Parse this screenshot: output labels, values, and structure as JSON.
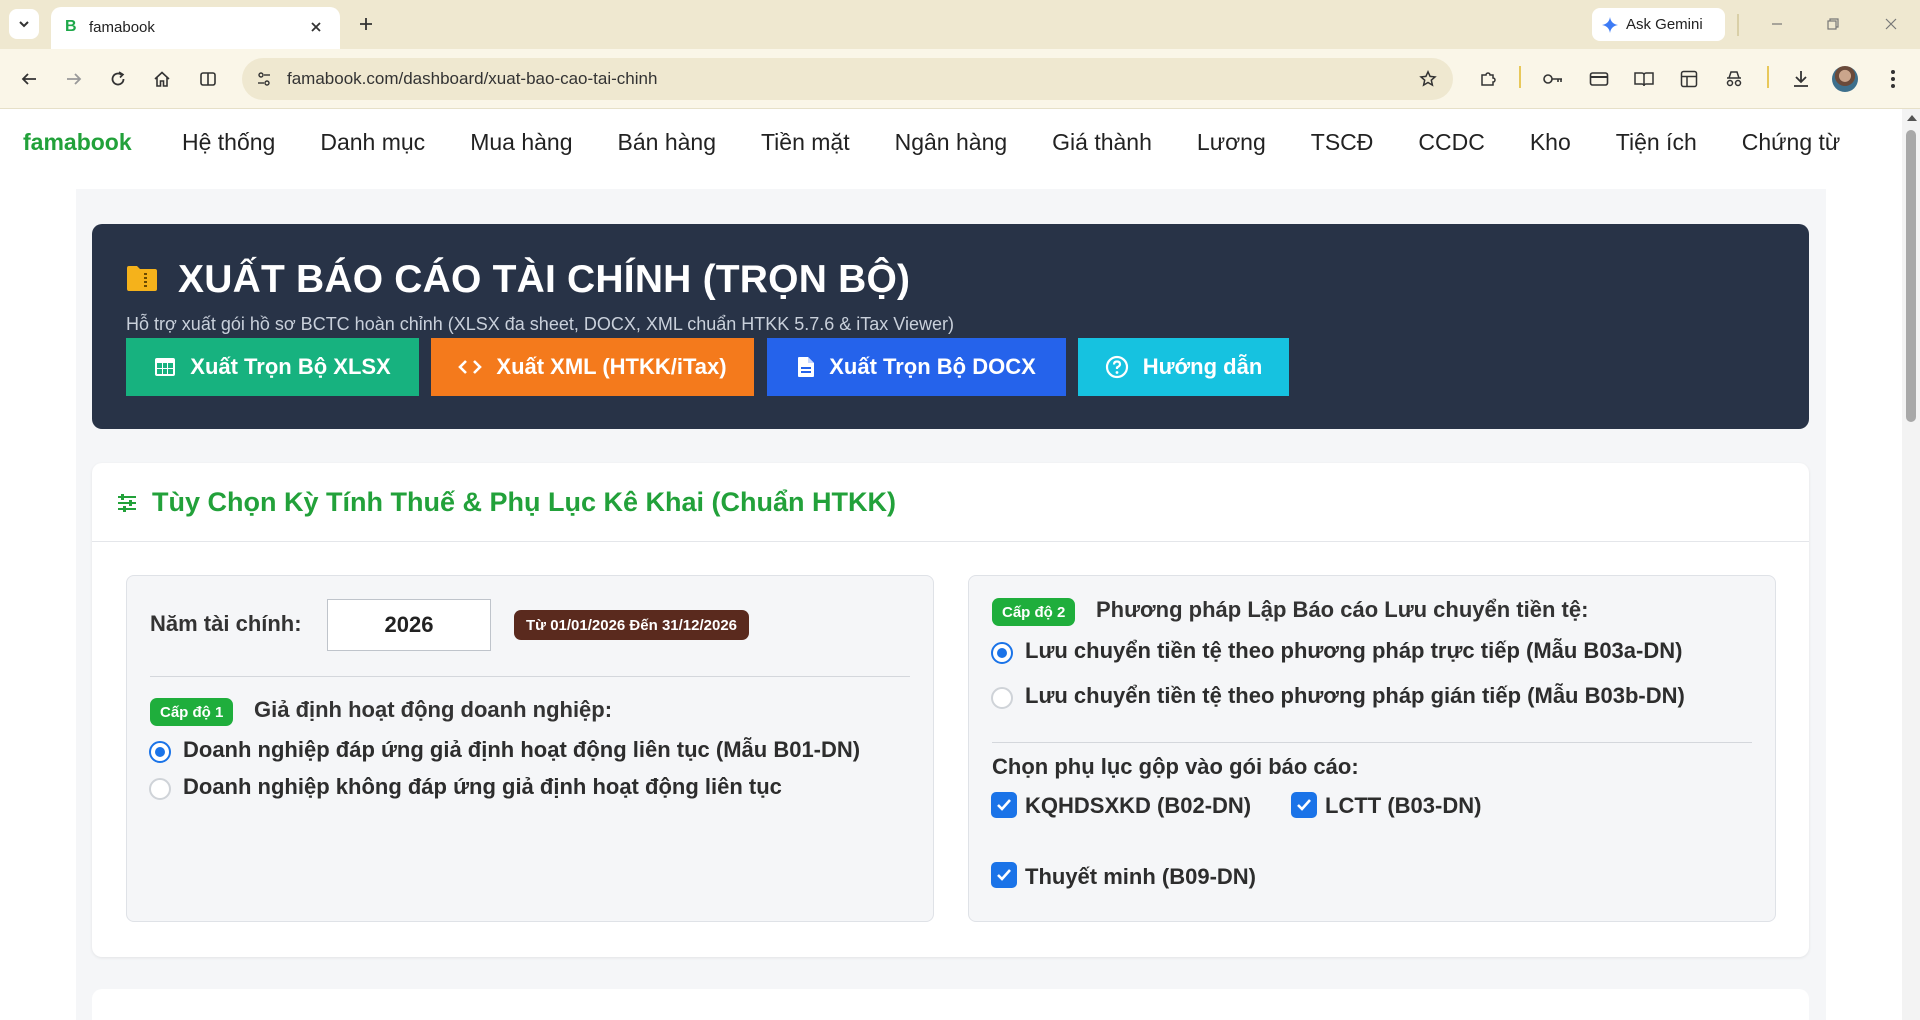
{
  "browser": {
    "tab_title": "famabook",
    "tab_favicon": "B",
    "url": "famabook.com/dashboard/xuat-bao-cao-tai-chinh",
    "gemini_label": "Ask Gemini"
  },
  "topnav": {
    "brand": "famabook",
    "items": [
      "Hệ thống",
      "Danh mục",
      "Mua hàng",
      "Bán hàng",
      "Tiền mặt",
      "Ngân hàng",
      "Giá thành",
      "Lương",
      "TSCĐ",
      "CCDC",
      "Kho",
      "Tiện ích",
      "Chứng từ"
    ]
  },
  "hero": {
    "icon": "folder-icon",
    "title": "XUẤT BÁO CÁO TÀI CHÍNH (TRỌN BỘ)",
    "subtitle": "Hỗ trợ xuất gói hồ sơ BCTC hoàn chỉnh (XLSX đa sheet, DOCX, XML chuẩn HTKK 5.7.6 & iTax Viewer)",
    "buttons": {
      "xlsx": "Xuất Trọn Bộ XLSX",
      "xml": "Xuất XML (HTKK/iTax)",
      "docx": "Xuất Trọn Bộ DOCX",
      "guide": "Hướng dẫn"
    },
    "colors": {
      "bg": "#283347",
      "xlsx": "#17b27f",
      "xml": "#f47a1c",
      "docx": "#2563eb",
      "guide": "#16c2e0"
    }
  },
  "options": {
    "title": "Tùy Chọn Kỳ Tính Thuế & Phụ Lục Kê Khai (Chuẩn HTKK)",
    "fiscal_year_label": "Năm tài chính:",
    "fiscal_year_value": "2026",
    "date_range": "Từ 01/01/2026 Đến 31/12/2026",
    "level1": {
      "badge": "Cấp độ 1",
      "heading": "Giả định hoạt động doanh nghiệp:",
      "options": [
        {
          "label": "Doanh nghiệp đáp ứng giả định hoạt động liên tục (Mẫu B01-DN)",
          "checked": true
        },
        {
          "label": "Doanh nghiệp không đáp ứng giả định hoạt động liên tục",
          "checked": false
        }
      ]
    },
    "level2": {
      "badge": "Cấp độ 2",
      "heading": "Phương pháp Lập Báo cáo Lưu chuyển tiền tệ:",
      "options": [
        {
          "label": "Lưu chuyển tiền tệ theo phương pháp trực tiếp (Mẫu B03a-DN)",
          "checked": true
        },
        {
          "label": "Lưu chuyển tiền tệ theo phương pháp gián tiếp (Mẫu B03b-DN)",
          "checked": false
        }
      ]
    },
    "appendix": {
      "heading": "Chọn phụ lục gộp vào gói báo cáo:",
      "items": [
        {
          "label": "KQHDSXKD (B02-DN)",
          "checked": true
        },
        {
          "label": "LCTT (B03-DN)",
          "checked": true
        },
        {
          "label": "Thuyết minh (B09-DN)",
          "checked": true
        }
      ]
    }
  }
}
